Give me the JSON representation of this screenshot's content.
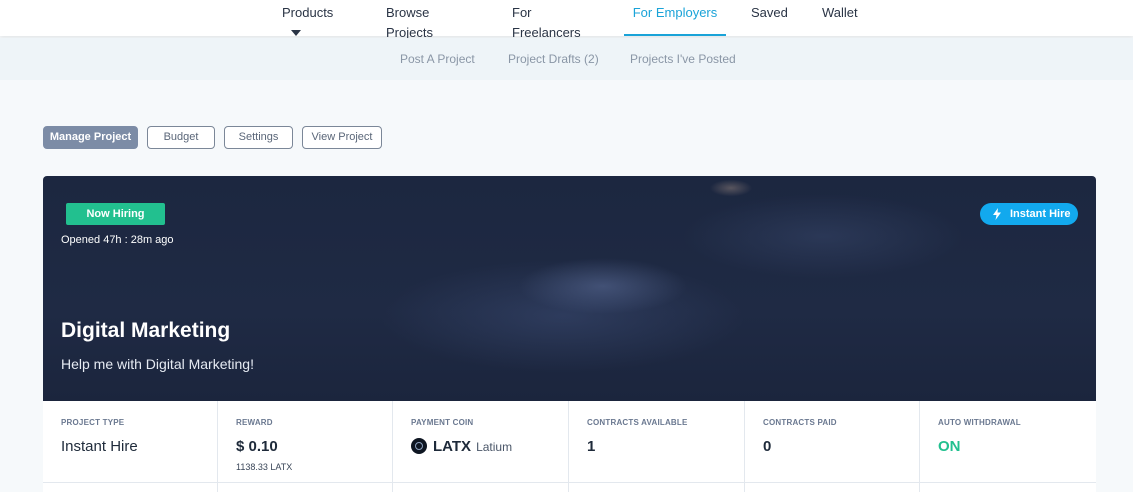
{
  "topnav": {
    "items": [
      {
        "label": "Products"
      },
      {
        "label": "Browse Projects"
      },
      {
        "label": "For Freelancers"
      },
      {
        "label": "For Employers"
      },
      {
        "label": "Saved"
      },
      {
        "label": "Wallet"
      }
    ],
    "active": "For Employers",
    "accent_color": "#1aa3d8"
  },
  "subnav": {
    "items": [
      {
        "label": "Post A Project"
      },
      {
        "label": "Project Drafts (2)"
      },
      {
        "label": "Projects I've Posted"
      }
    ]
  },
  "tabs": {
    "items": [
      {
        "label": "Manage Project"
      },
      {
        "label": "Budget"
      },
      {
        "label": "Settings"
      },
      {
        "label": "View Project"
      }
    ],
    "active": "Manage Project"
  },
  "hero": {
    "status_badge": "Now Hiring",
    "opened": "Opened 47h : 28m ago",
    "instant_badge": "Instant Hire",
    "title": "Digital Marketing",
    "subtitle": "Help me with Digital Marketing!",
    "status_color": "#22c08f",
    "instant_color": "#12a9ee"
  },
  "stats": {
    "project_type": {
      "label": "PROJECT TYPE",
      "value": "Instant Hire"
    },
    "reward": {
      "label": "REWARD",
      "value": "$ 0.10",
      "sub": "1138.33 LATX"
    },
    "payment_coin": {
      "label": "PAYMENT COIN",
      "value": "LATX",
      "name": "Latium",
      "icon": "latium-coin-icon"
    },
    "contracts_available": {
      "label": "CONTRACTS AVAILABLE",
      "value": "1"
    },
    "contracts_paid": {
      "label": "CONTRACTS PAID",
      "value": "0"
    },
    "auto_withdrawal": {
      "label": "AUTO WITHDRAWAL",
      "value": "ON",
      "color": "#22c08f"
    }
  }
}
